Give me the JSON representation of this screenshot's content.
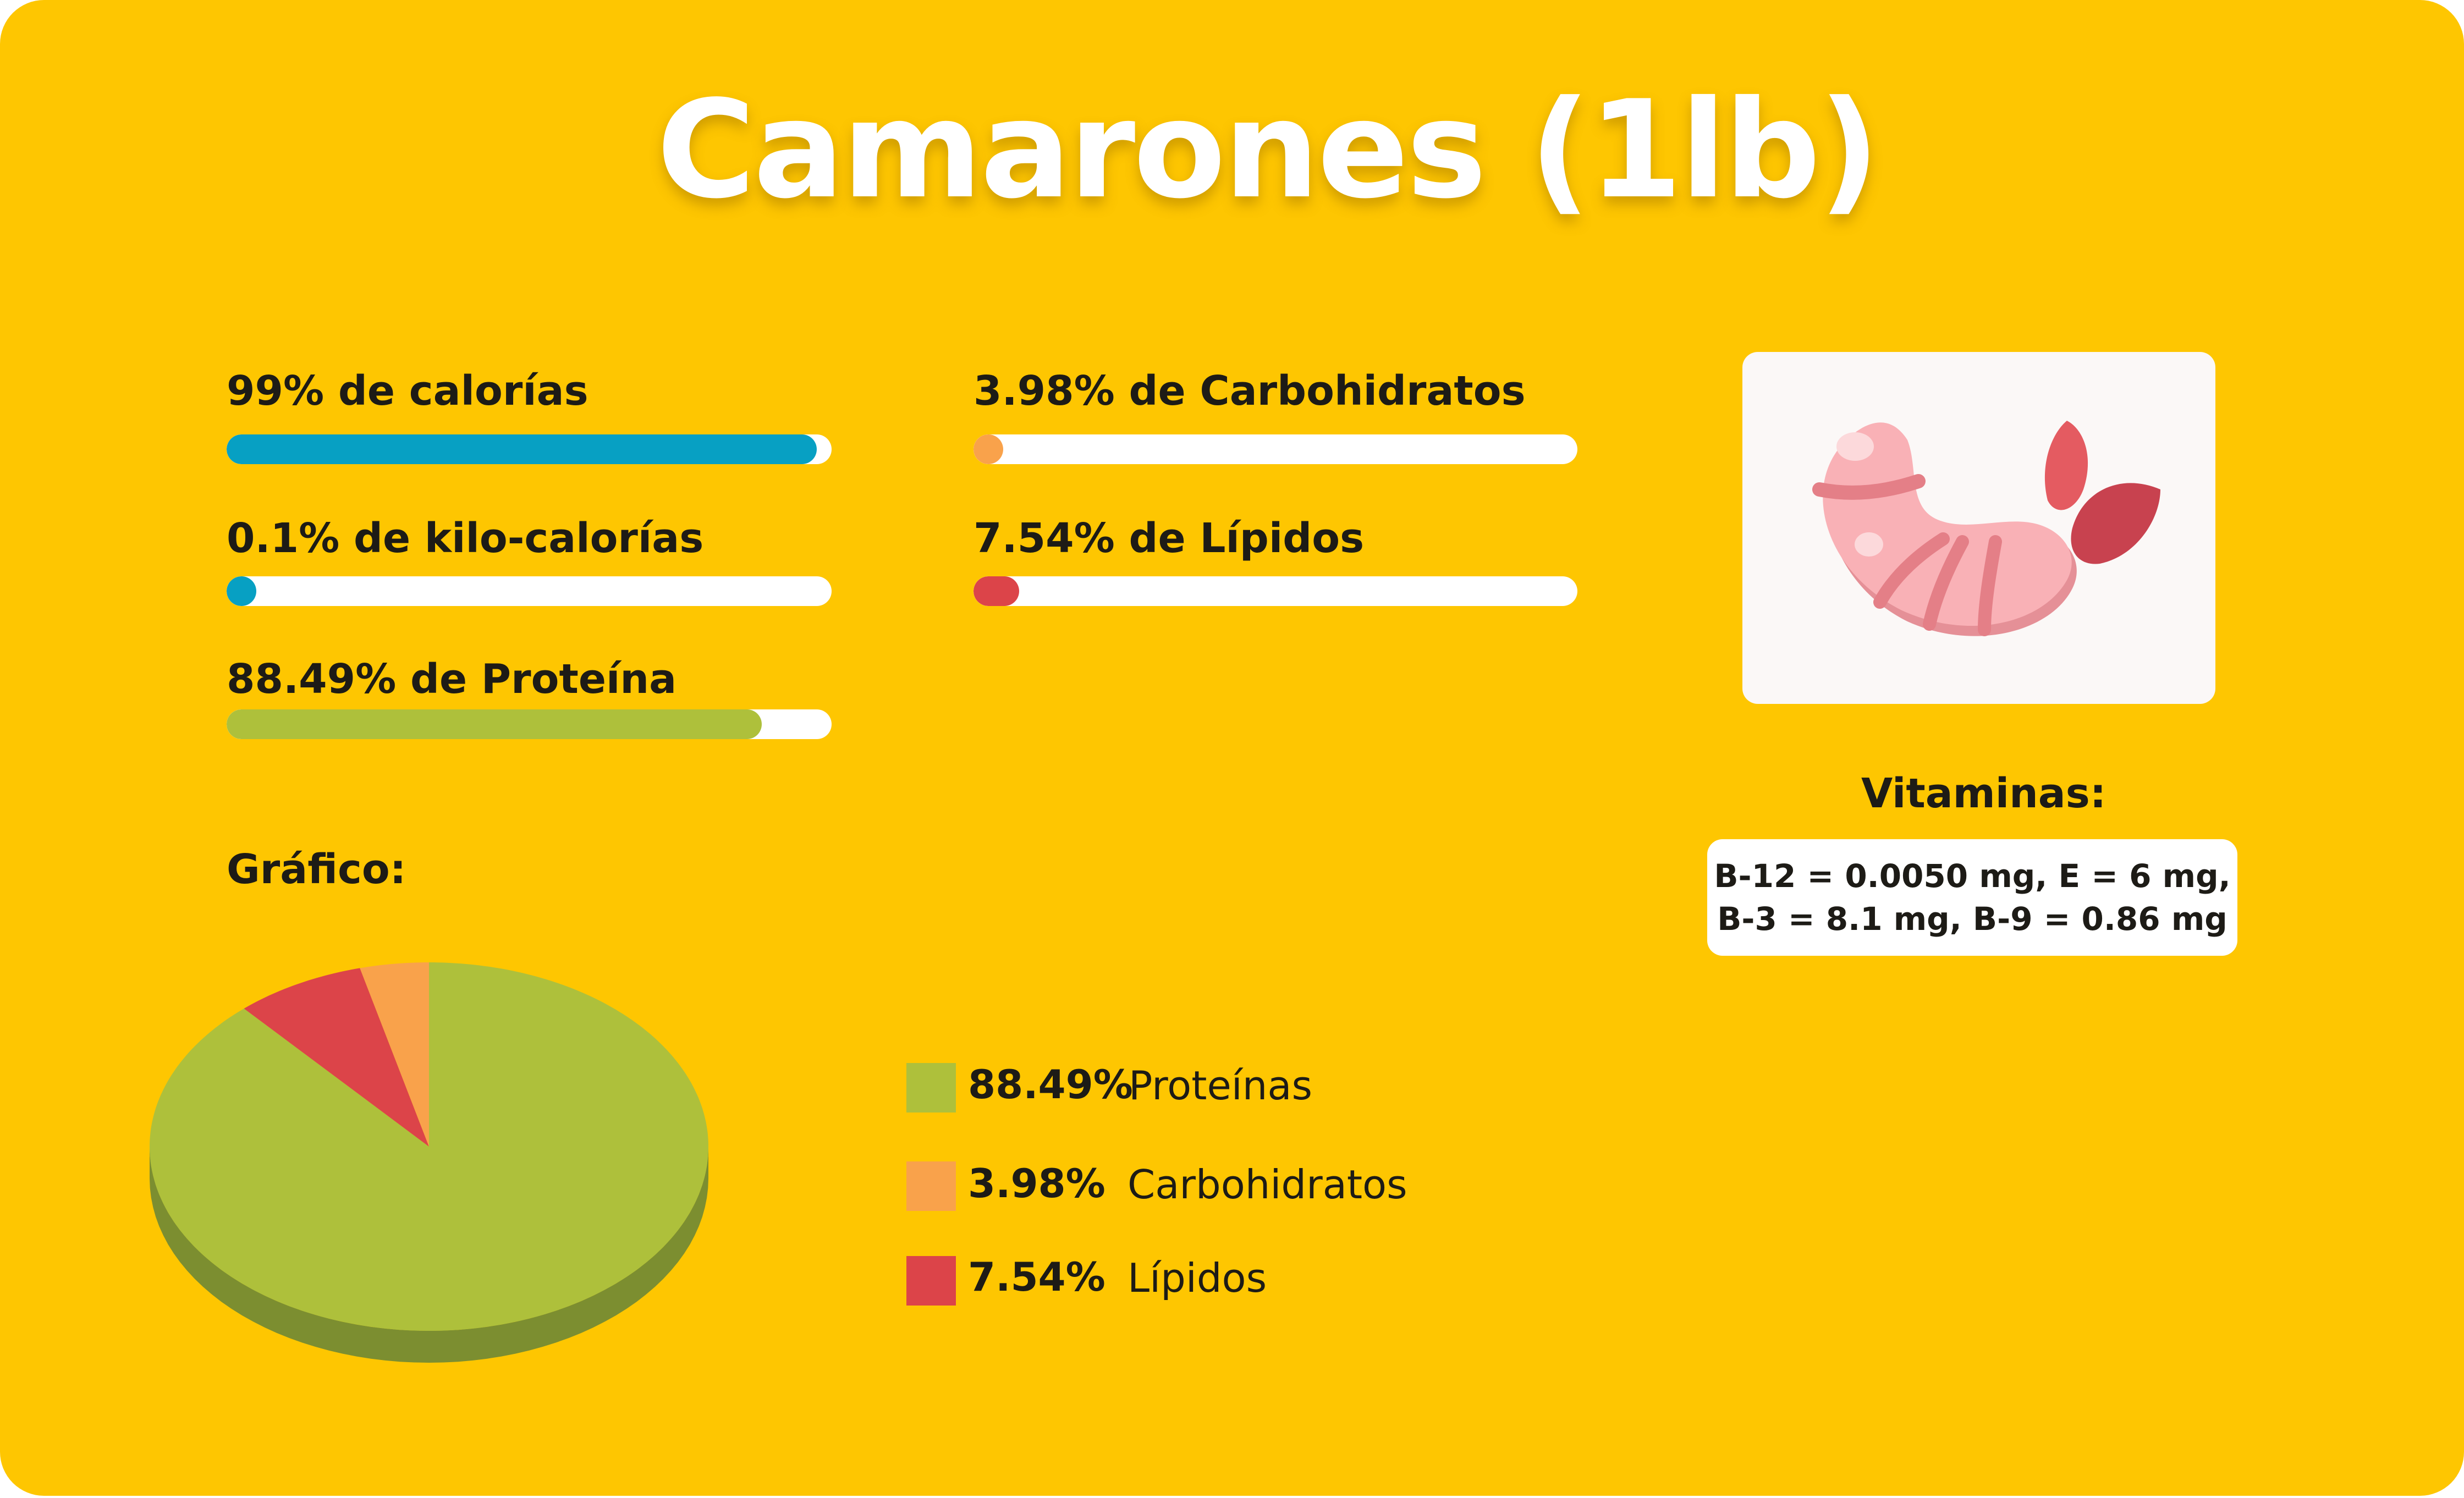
{
  "title": "Camarones (1lb)",
  "bars": [
    {
      "label": "99% de calorías",
      "percent": 97.5,
      "color": "#07A0C3"
    },
    {
      "label": "0.1% de kilo-calorías",
      "percent": 0.1,
      "color": "#07A0C3"
    },
    {
      "label": "88.49% de Proteína",
      "percent": 88.49,
      "color": "#AEC03B"
    },
    {
      "label": "3.98% de Carbohidratos",
      "percent": 3.98,
      "color": "#F9A24B"
    },
    {
      "label": "7.54% de Lípidos",
      "percent": 7.54,
      "color": "#DC4449"
    }
  ],
  "image": {
    "icon": "shrimp-icon"
  },
  "vitamins": {
    "label": "Vitaminas:",
    "line1": "B-12 = 0.0050 mg, E = 6 mg,",
    "line2": "B-3 = 8.1 mg, B-9 = 0.86 mg"
  },
  "chart_label": "Gráfico:",
  "chart_data": {
    "type": "pie",
    "title": "",
    "slices": [
      {
        "name": "Proteínas",
        "value": 88.49,
        "value_label": "88.49%",
        "color": "#AEC03B",
        "side_color": "#7C8E30"
      },
      {
        "name": "Carbohidratos",
        "value": 3.98,
        "value_label": "3.98%",
        "color": "#F9A24B",
        "side_color": "#C77A2E"
      },
      {
        "name": "Lípidos",
        "value": 7.54,
        "value_label": "7.54%",
        "color": "#DC4449",
        "side_color": "#A8322F"
      }
    ],
    "legend_position": "right",
    "style": "3d"
  }
}
